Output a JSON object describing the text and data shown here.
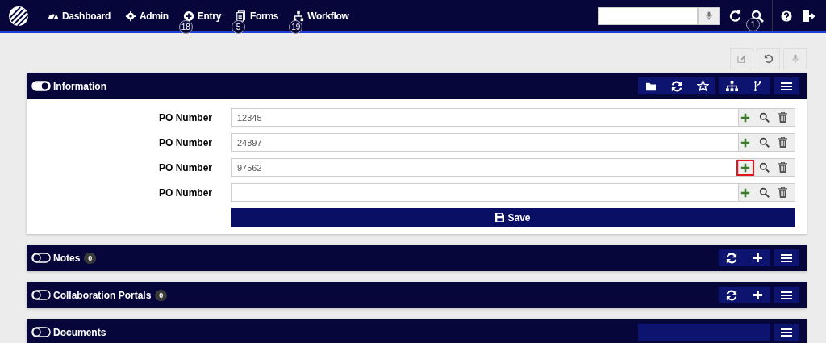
{
  "nav": {
    "items": [
      {
        "label": "Dashboard",
        "kind": "dashboard"
      },
      {
        "label": "Admin",
        "kind": "admin"
      },
      {
        "label": "Entry",
        "kind": "entry",
        "badge": "18"
      },
      {
        "label": "Forms",
        "kind": "forms",
        "badge": "5"
      },
      {
        "label": "Workflow",
        "kind": "workflow",
        "badge": "19"
      }
    ],
    "search": {
      "badge": "1"
    }
  },
  "panels": [
    {
      "title": "Information",
      "expanded": true,
      "fields": [
        {
          "label": "PO Number",
          "value": "12345",
          "add_highlighted": false
        },
        {
          "label": "PO Number",
          "value": "24897",
          "add_highlighted": false
        },
        {
          "label": "PO Number",
          "value": "97562",
          "add_highlighted": true
        },
        {
          "label": "PO Number",
          "add_highlighted": false
        }
      ],
      "save": "Save"
    },
    {
      "title": "Notes",
      "expanded": false,
      "count": "0"
    },
    {
      "title": "Collaboration Portals",
      "expanded": false,
      "count": "0"
    },
    {
      "title": "Documents",
      "expanded": false
    }
  ]
}
